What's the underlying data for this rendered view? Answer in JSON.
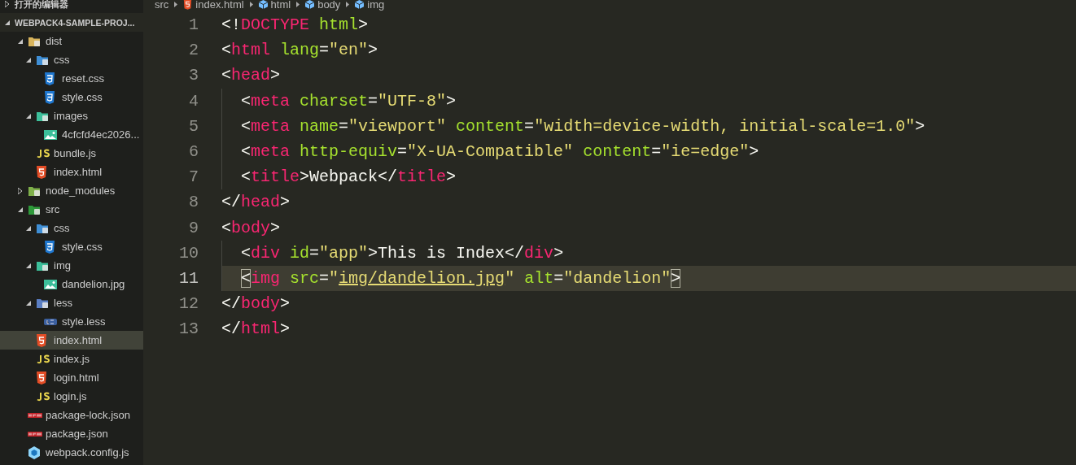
{
  "sidebar": {
    "sections": [
      {
        "title": "打开的编辑器",
        "expanded": false
      },
      {
        "title": "WEBPACK4-SAMPLE-PROJ...",
        "expanded": true
      }
    ],
    "tree": [
      {
        "label": "dist",
        "kind": "folder-dist",
        "expanded": true,
        "selected": false,
        "children": [
          {
            "label": "css",
            "kind": "folder-css",
            "expanded": true,
            "selected": false,
            "children": [
              {
                "label": "reset.css",
                "kind": "css",
                "selected": false
              },
              {
                "label": "style.css",
                "kind": "css",
                "selected": false
              }
            ]
          },
          {
            "label": "images",
            "kind": "folder-images",
            "expanded": true,
            "selected": false,
            "children": [
              {
                "label": "4cfcfd4ec2026...",
                "kind": "image",
                "selected": false
              }
            ]
          },
          {
            "label": "bundle.js",
            "kind": "js",
            "selected": false
          },
          {
            "label": "index.html",
            "kind": "html",
            "selected": false
          }
        ]
      },
      {
        "label": "node_modules",
        "kind": "folder-node",
        "expanded": false,
        "selected": false
      },
      {
        "label": "src",
        "kind": "folder-src",
        "expanded": true,
        "selected": false,
        "children": [
          {
            "label": "css",
            "kind": "folder-css",
            "expanded": true,
            "selected": false,
            "children": [
              {
                "label": "style.css",
                "kind": "css",
                "selected": false
              }
            ]
          },
          {
            "label": "img",
            "kind": "folder-images",
            "expanded": true,
            "selected": false,
            "children": [
              {
                "label": "dandelion.jpg",
                "kind": "image",
                "selected": false
              }
            ]
          },
          {
            "label": "less",
            "kind": "folder-less",
            "expanded": true,
            "selected": false,
            "children": [
              {
                "label": "style.less",
                "kind": "less",
                "selected": false
              }
            ]
          },
          {
            "label": "index.html",
            "kind": "html",
            "selected": true
          },
          {
            "label": "index.js",
            "kind": "js",
            "selected": false
          },
          {
            "label": "login.html",
            "kind": "html",
            "selected": false
          },
          {
            "label": "login.js",
            "kind": "js",
            "selected": false
          }
        ]
      },
      {
        "label": "package-lock.json",
        "kind": "npm",
        "selected": false
      },
      {
        "label": "package.json",
        "kind": "npm",
        "selected": false
      },
      {
        "label": "webpack.config.js",
        "kind": "webpack",
        "selected": false
      }
    ]
  },
  "breadcrumb": [
    {
      "label": "src",
      "kind": "folder"
    },
    {
      "label": "index.html",
      "kind": "html"
    },
    {
      "label": "html",
      "kind": "element"
    },
    {
      "label": "body",
      "kind": "element"
    },
    {
      "label": "img",
      "kind": "element"
    }
  ],
  "editor": {
    "lines": [
      {
        "number": "1",
        "current": false,
        "tokens": [
          {
            "kind": "punct",
            "text": "<!"
          },
          {
            "kind": "tag",
            "text": "DOCTYPE"
          },
          {
            "kind": "attr",
            "text": " html"
          },
          {
            "kind": "punct",
            "text": ">"
          }
        ]
      },
      {
        "number": "2",
        "current": false,
        "tokens": [
          {
            "kind": "punct",
            "text": "<"
          },
          {
            "kind": "tag",
            "text": "html"
          },
          {
            "kind": "attr",
            "text": " lang"
          },
          {
            "kind": "punct",
            "text": "="
          },
          {
            "kind": "string",
            "text": "\"en\""
          },
          {
            "kind": "punct",
            "text": ">"
          }
        ]
      },
      {
        "number": "3",
        "current": false,
        "tokens": [
          {
            "kind": "punct",
            "text": "<"
          },
          {
            "kind": "tag",
            "text": "head"
          },
          {
            "kind": "punct",
            "text": ">"
          }
        ]
      },
      {
        "number": "4",
        "current": false,
        "indented": true,
        "tokens": [
          {
            "kind": "punct",
            "text": "<"
          },
          {
            "kind": "tag",
            "text": "meta"
          },
          {
            "kind": "attr",
            "text": " charset"
          },
          {
            "kind": "punct",
            "text": "="
          },
          {
            "kind": "string",
            "text": "\"UTF-8\""
          },
          {
            "kind": "punct",
            "text": ">"
          }
        ]
      },
      {
        "number": "5",
        "current": false,
        "indented": true,
        "tokens": [
          {
            "kind": "punct",
            "text": "<"
          },
          {
            "kind": "tag",
            "text": "meta"
          },
          {
            "kind": "attr",
            "text": " name"
          },
          {
            "kind": "punct",
            "text": "="
          },
          {
            "kind": "string",
            "text": "\"viewport\""
          },
          {
            "kind": "attr",
            "text": " content"
          },
          {
            "kind": "punct",
            "text": "="
          },
          {
            "kind": "string",
            "text": "\"width=device-width, initial-scale=1.0\""
          },
          {
            "kind": "punct",
            "text": ">"
          }
        ]
      },
      {
        "number": "6",
        "current": false,
        "indented": true,
        "tokens": [
          {
            "kind": "punct",
            "text": "<"
          },
          {
            "kind": "tag",
            "text": "meta"
          },
          {
            "kind": "attr",
            "text": " http-equiv"
          },
          {
            "kind": "punct",
            "text": "="
          },
          {
            "kind": "string",
            "text": "\"X-UA-Compatible\""
          },
          {
            "kind": "attr",
            "text": " content"
          },
          {
            "kind": "punct",
            "text": "="
          },
          {
            "kind": "string",
            "text": "\"ie=edge\""
          },
          {
            "kind": "punct",
            "text": ">"
          }
        ]
      },
      {
        "number": "7",
        "current": false,
        "indented": true,
        "tokens": [
          {
            "kind": "punct",
            "text": "<"
          },
          {
            "kind": "tag",
            "text": "title"
          },
          {
            "kind": "punct",
            "text": ">Webpack</"
          },
          {
            "kind": "tag",
            "text": "title"
          },
          {
            "kind": "punct",
            "text": ">"
          }
        ]
      },
      {
        "number": "8",
        "current": false,
        "tokens": [
          {
            "kind": "punct",
            "text": "</"
          },
          {
            "kind": "tag",
            "text": "head"
          },
          {
            "kind": "punct",
            "text": ">"
          }
        ]
      },
      {
        "number": "9",
        "current": false,
        "tokens": [
          {
            "kind": "punct",
            "text": "<"
          },
          {
            "kind": "tag",
            "text": "body"
          },
          {
            "kind": "punct",
            "text": ">"
          }
        ]
      },
      {
        "number": "10",
        "current": false,
        "indented": true,
        "tokens": [
          {
            "kind": "punct",
            "text": "<"
          },
          {
            "kind": "tag",
            "text": "div"
          },
          {
            "kind": "attr",
            "text": " id"
          },
          {
            "kind": "punct",
            "text": "="
          },
          {
            "kind": "string",
            "text": "\"app\""
          },
          {
            "kind": "punct",
            "text": ">This is Index</"
          },
          {
            "kind": "tag",
            "text": "div"
          },
          {
            "kind": "punct",
            "text": ">"
          }
        ]
      },
      {
        "number": "11",
        "current": true,
        "indented": true,
        "tokens": [
          {
            "kind": "punct",
            "text": "<",
            "matched": true
          },
          {
            "kind": "tag",
            "text": "img"
          },
          {
            "kind": "attr",
            "text": " src"
          },
          {
            "kind": "punct",
            "text": "="
          },
          {
            "kind": "string",
            "text": "\""
          },
          {
            "kind": "string",
            "text": "img/dandelion.jpg",
            "link": true
          },
          {
            "kind": "string",
            "text": "\""
          },
          {
            "kind": "attr",
            "text": " alt"
          },
          {
            "kind": "punct",
            "text": "="
          },
          {
            "kind": "string",
            "text": "\"dandelion\""
          },
          {
            "kind": "punct",
            "text": ">",
            "matched": true
          }
        ]
      },
      {
        "number": "12",
        "current": false,
        "tokens": [
          {
            "kind": "punct",
            "text": "</"
          },
          {
            "kind": "tag",
            "text": "body"
          },
          {
            "kind": "punct",
            "text": ">"
          }
        ]
      },
      {
        "number": "13",
        "current": false,
        "tokens": [
          {
            "kind": "punct",
            "text": "</"
          },
          {
            "kind": "tag",
            "text": "html"
          },
          {
            "kind": "punct",
            "text": ">"
          }
        ]
      }
    ]
  }
}
